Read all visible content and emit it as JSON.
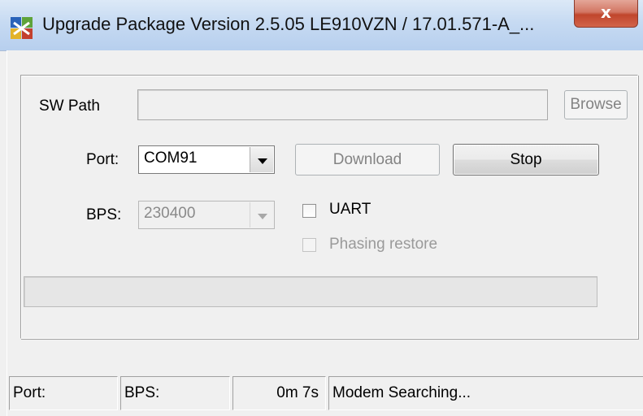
{
  "window": {
    "title": "Upgrade Package Version 2.5.05  LE910VZN / 17.01.571-A_...",
    "app_icon": "app-puzzle-icon",
    "close_icon": "close-icon",
    "close_glyph": "x",
    "close_color": "#c0452c"
  },
  "form": {
    "sw_path_label": "SW Path",
    "sw_path_value": "",
    "browse_label": "Browse",
    "port_label": "Port:",
    "port_value": "COM91",
    "download_label": "Download",
    "stop_label": "Stop",
    "bps_label": "BPS:",
    "bps_value": "230400",
    "uart_label": "UART",
    "uart_checked": false,
    "phasing_label": "Phasing restore",
    "phasing_checked": false,
    "progress": 0
  },
  "status": {
    "port": "Port:",
    "bps": "BPS:",
    "elapsed": "0m  7s",
    "message": "Modem Searching..."
  }
}
